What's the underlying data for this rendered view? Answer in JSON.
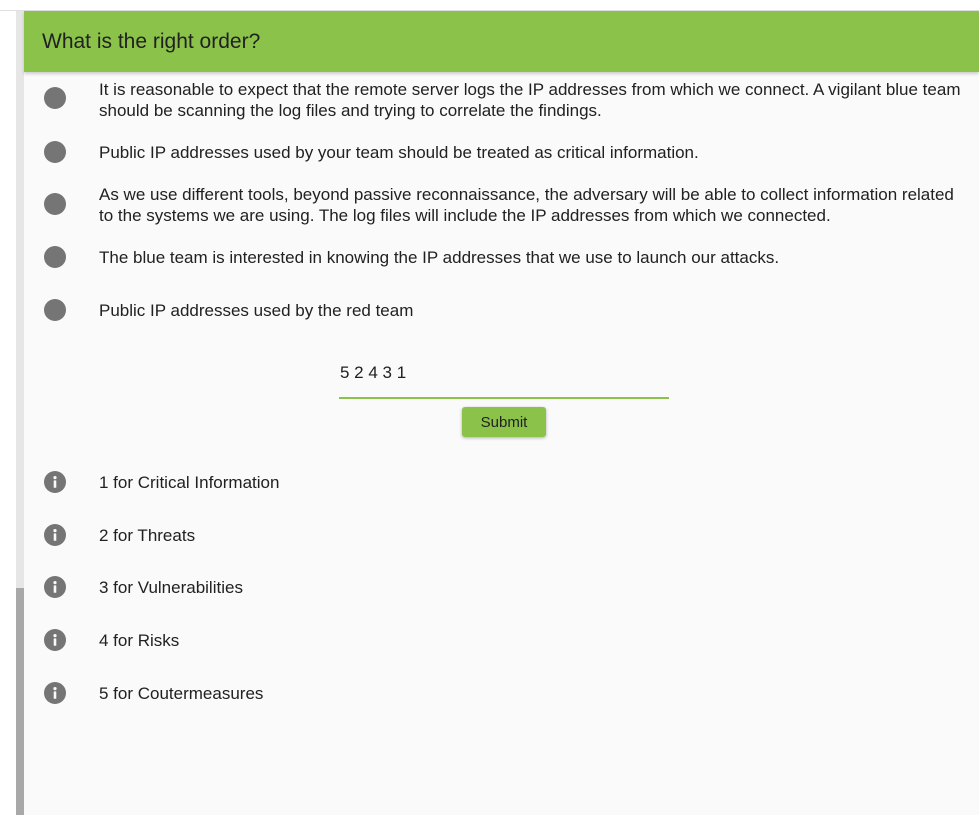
{
  "question": {
    "title": "What is the right order?"
  },
  "statements": [
    {
      "text": "It is reasonable to expect that the remote server logs the IP addresses from which we connect. A vigilant blue team should be scanning the log files and trying to correlate the findings."
    },
    {
      "text": "Public IP addresses used by your team should be treated as critical information."
    },
    {
      "text": "As we use different tools, beyond passive reconnaissance, the adversary will be able to collect information related to the systems we are using. The log files will include the IP addresses from which we connected."
    },
    {
      "text": "The blue team is interested in knowing the IP addresses that we use to launch our attacks."
    },
    {
      "text": "Public IP addresses used by the red team"
    }
  ],
  "answer": {
    "value": "5 2 4 3 1"
  },
  "submit": {
    "label": "Submit"
  },
  "hints": [
    {
      "text": "1 for Critical Information",
      "icon": "info-icon"
    },
    {
      "text": "2 for Threats",
      "icon": "info-icon"
    },
    {
      "text": "3 for Vulnerabilities",
      "icon": "info-icon"
    },
    {
      "text": "4 for Risks",
      "icon": "info-icon"
    },
    {
      "text": "5 for Coutermeasures",
      "icon": "info-icon"
    }
  ],
  "colors": {
    "accent": "#8bc34a",
    "bullet": "#757575",
    "background": "#fafafa"
  }
}
